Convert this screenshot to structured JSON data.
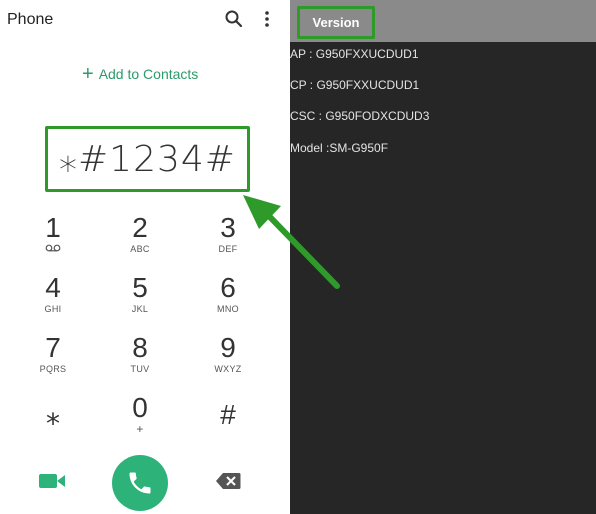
{
  "dialer": {
    "app_title": "Phone",
    "add_contacts_label": "Add to Contacts",
    "number": "⁎#1234#",
    "keys": [
      {
        "digit": "1",
        "letters": ""
      },
      {
        "digit": "2",
        "letters": "ABC"
      },
      {
        "digit": "3",
        "letters": "DEF"
      },
      {
        "digit": "4",
        "letters": "GHI"
      },
      {
        "digit": "5",
        "letters": "JKL"
      },
      {
        "digit": "6",
        "letters": "MNO"
      },
      {
        "digit": "7",
        "letters": "PQRS"
      },
      {
        "digit": "8",
        "letters": "TUV"
      },
      {
        "digit": "9",
        "letters": "WXYZ"
      },
      {
        "digit": "⁎",
        "letters": ""
      },
      {
        "digit": "0",
        "letters": "+"
      },
      {
        "digit": "#",
        "letters": ""
      }
    ],
    "accent_color": "#2db37a",
    "icons": {
      "search": "search-icon",
      "more": "more-vert-icon",
      "voicemail": "voicemail-icon",
      "video": "video-call-icon",
      "call": "phone-icon",
      "backspace": "backspace-icon"
    }
  },
  "version": {
    "header_title": "Version",
    "lines": [
      "AP : G950FXXUCDUD1",
      "CP : G950FXXUCDUD1",
      "CSC : G950FODXCDUD3",
      "Model :SM-G950F"
    ]
  },
  "highlight_color": "#2e9a2a"
}
